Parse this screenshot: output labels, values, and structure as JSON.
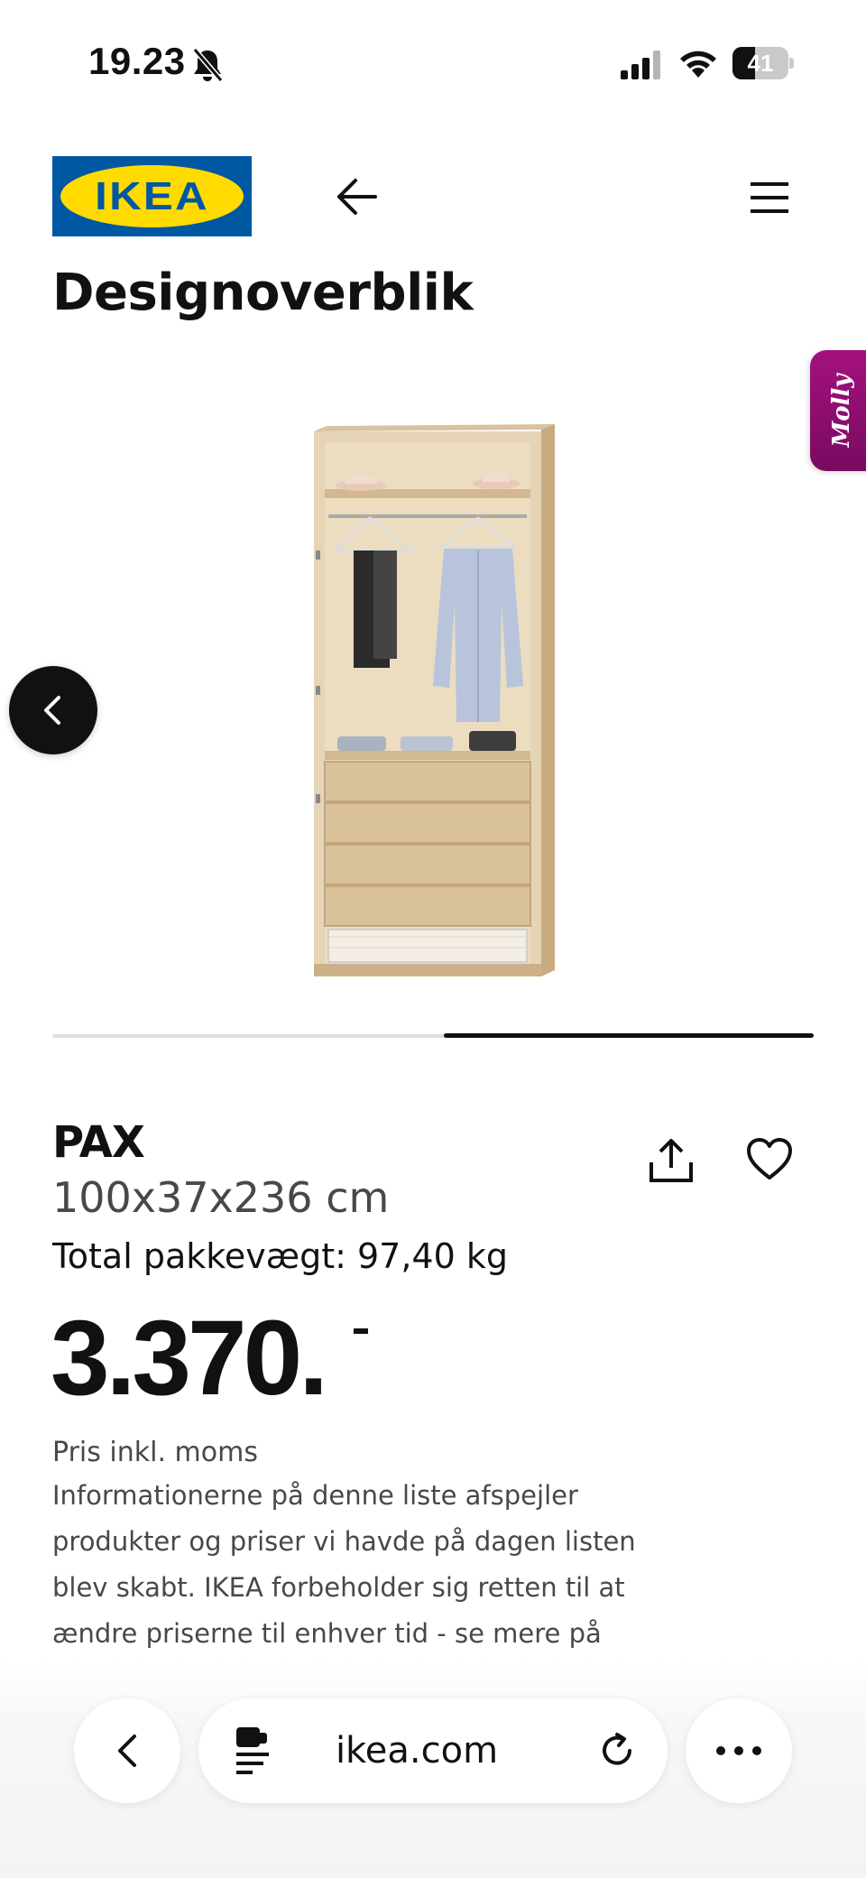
{
  "status_bar": {
    "time": "19.23",
    "battery_level": "41",
    "icons": [
      "bell-slash-icon",
      "cellular-signal-icon",
      "wifi-icon",
      "battery-icon"
    ]
  },
  "header": {
    "logo_text": "IKEA",
    "colors": {
      "logo_blue": "#0058a3",
      "logo_yellow": "#ffdb00"
    },
    "icons": [
      "back-arrow-icon",
      "hamburger-menu-icon"
    ]
  },
  "page": {
    "title": "Designoverblik"
  },
  "assistant_tab": {
    "label": "Molly",
    "color": "#a3117e"
  },
  "carousel": {
    "slide_count": 2,
    "active_slide": 2,
    "icons": [
      "chevron-left-icon"
    ]
  },
  "product": {
    "name": "PAX",
    "dimensions": "100x37x236 cm",
    "weight": "Total pakkevægt: 97,40 kg",
    "price": "3.370.",
    "price_note": "Pris inkl. moms",
    "info_text": "Informationerne på denne liste afspejler produkter og priser vi havde på dagen listen blev skabt. IKEA forbeholder sig retten til at ændre priserne til enhver tid - se mere på",
    "icons": [
      "share-icon",
      "heart-icon"
    ]
  },
  "browser_bar": {
    "url": "ikea.com",
    "icons": [
      "chevron-left-icon",
      "page-settings-icon",
      "reload-icon",
      "more-icon"
    ]
  }
}
